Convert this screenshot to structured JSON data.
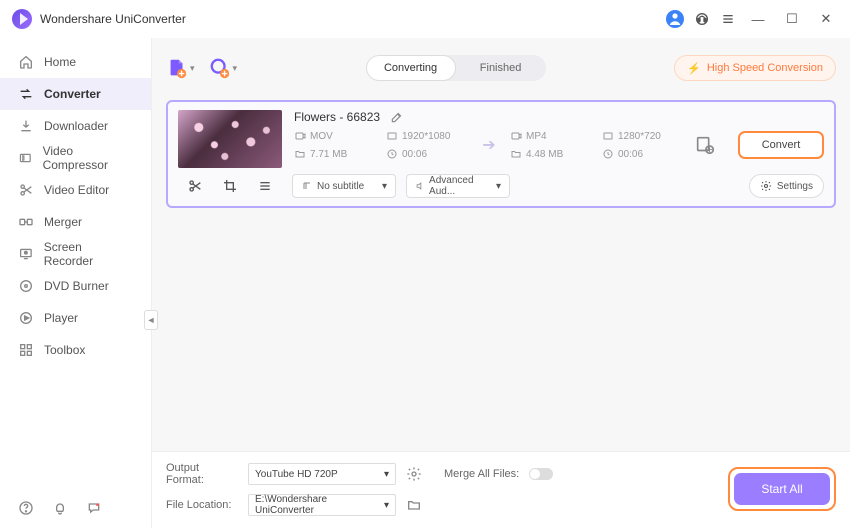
{
  "app_title": "Wondershare UniConverter",
  "sidebar": {
    "items": [
      {
        "label": "Home"
      },
      {
        "label": "Converter"
      },
      {
        "label": "Downloader"
      },
      {
        "label": "Video Compressor"
      },
      {
        "label": "Video Editor"
      },
      {
        "label": "Merger"
      },
      {
        "label": "Screen Recorder"
      },
      {
        "label": "DVD Burner"
      },
      {
        "label": "Player"
      },
      {
        "label": "Toolbox"
      }
    ]
  },
  "tabs": {
    "converting": "Converting",
    "finished": "Finished"
  },
  "hsc_label": "High Speed Conversion",
  "file": {
    "name": "Flowers - 66823",
    "src": {
      "format": "MOV",
      "resolution": "1920*1080",
      "size": "7.71 MB",
      "duration": "00:06"
    },
    "dst": {
      "format": "MP4",
      "resolution": "1280*720",
      "size": "4.48 MB",
      "duration": "00:06"
    },
    "convert_label": "Convert",
    "subtitle": "No subtitle",
    "audio": "Advanced Aud...",
    "settings": "Settings"
  },
  "bottom": {
    "output_format_label": "Output Format:",
    "output_format_value": "YouTube HD 720P",
    "merge_label": "Merge All Files:",
    "file_location_label": "File Location:",
    "file_location_value": "E:\\Wondershare UniConverter",
    "start_all": "Start All"
  }
}
